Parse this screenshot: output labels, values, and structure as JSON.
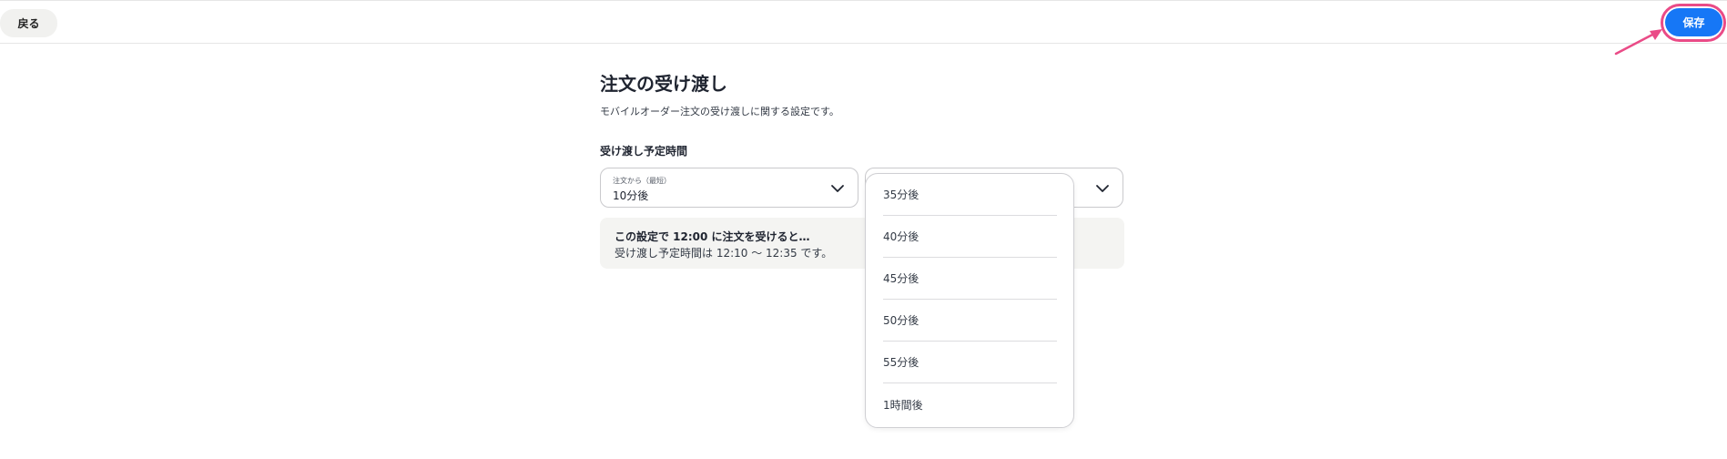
{
  "header": {
    "back_label": "戻る",
    "save_label": "保存",
    "accent_color": "#1677f6",
    "highlight_color": "#ea4b87"
  },
  "main": {
    "title": "注文の受け渡し",
    "description": "モバイルオーダー注文の受け渡しに関する設定です。",
    "section_label": "受け渡し予定時間",
    "min_select": {
      "caption": "注文から（最短）",
      "value": "10分後"
    },
    "max_select": {
      "caption": "",
      "value": ""
    },
    "info": {
      "title": "この設定で 12:00 に注文を受けると…",
      "text": "受け渡し予定時間は 12:10 〜 12:35 です。"
    }
  },
  "dropdown": {
    "options": [
      "35分後",
      "40分後",
      "45分後",
      "50分後",
      "55分後",
      "1時間後"
    ]
  },
  "icons": {
    "chevron": "chevron-down-icon",
    "arrow": "arrow-icon"
  }
}
